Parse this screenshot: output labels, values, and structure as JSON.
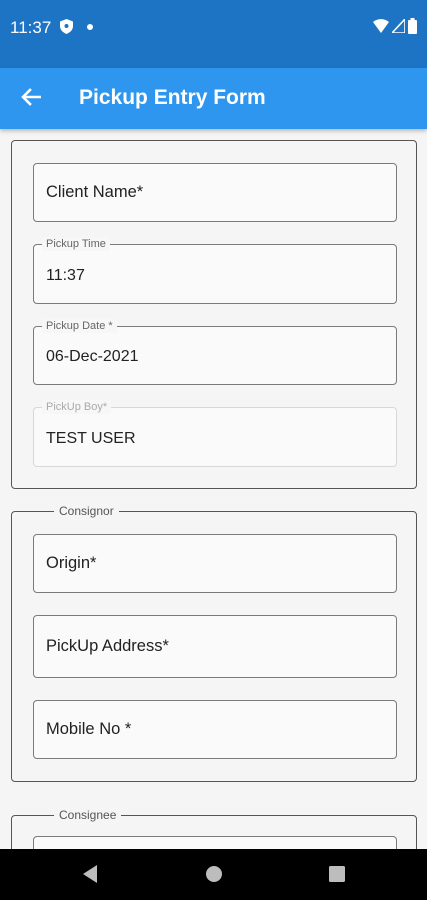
{
  "status_bar": {
    "time": "11:37",
    "icons": [
      "shield-icon",
      "notification-dot-icon",
      "wifi-icon",
      "signal-icon",
      "battery-icon"
    ]
  },
  "app_bar": {
    "title": "Pickup Entry Form",
    "back_icon": "arrow-back-icon"
  },
  "section_general": {
    "fields": {
      "client_name": {
        "placeholder": "Client Name*"
      },
      "pickup_time": {
        "label": "Pickup Time",
        "value": "11:37"
      },
      "pickup_date": {
        "label": "Pickup Date *",
        "value": "06-Dec-2021"
      },
      "pickup_boy": {
        "label": "PickUp Boy*",
        "value": "TEST USER"
      }
    }
  },
  "section_consignor": {
    "legend": "Consignor",
    "fields": {
      "origin": {
        "placeholder": "Origin*"
      },
      "pickup_address": {
        "placeholder": "PickUp Address*"
      },
      "mobile_no": {
        "placeholder": "Mobile No *"
      }
    }
  },
  "section_consignee": {
    "legend": "Consignee"
  },
  "nav_bar": {
    "icons": [
      "back-triangle-icon",
      "home-circle-icon",
      "recents-square-icon"
    ]
  },
  "colors": {
    "status_bar": "#1e74c4",
    "app_bar": "#2e96ef",
    "background": "#f5f5f5",
    "border": "#555555"
  }
}
